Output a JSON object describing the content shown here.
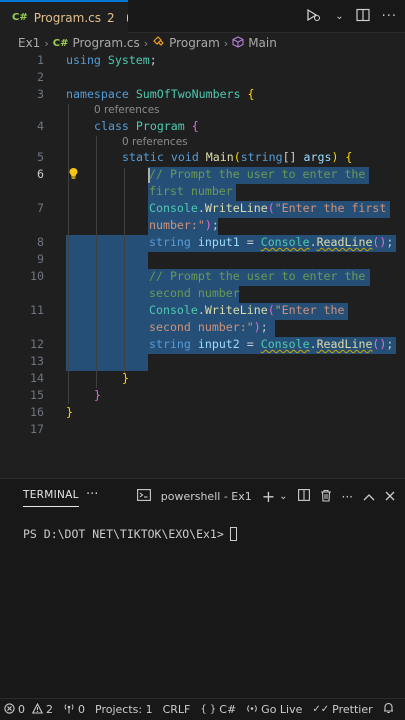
{
  "tab": {
    "lang_icon": "C#",
    "name": "Program.cs",
    "problems": "2"
  },
  "breadcrumb": {
    "folder": "Ex1",
    "file_icon": "C#",
    "file": "Program.cs",
    "class": "Program",
    "method": "Main"
  },
  "editor": {
    "line_numbers": [
      "1",
      "2",
      "3",
      "4",
      "5",
      "6",
      "7",
      "8",
      "9",
      "10",
      "11",
      "12",
      "13",
      "14",
      "15",
      "16",
      "17"
    ],
    "code": {
      "l1_kw": "using",
      "l1_ns": "System",
      "l3_kw": "namespace",
      "l3_name": "SumOfTwoNumbers",
      "l4_kw": "class",
      "l4_name": "Program",
      "l5_static": "static",
      "l5_void": "void",
      "l5_main": "Main",
      "l5_string": "string",
      "l5_args": "args",
      "l6_comment_a": "// Prompt the user to enter the",
      "l6_comment_b": "first number",
      "l7_console": "Console",
      "l7_method": "WriteLine",
      "l7_str_a": "\"Enter the first",
      "l7_str_b": "number:\"",
      "l8_string": "string",
      "l8_var": "input1",
      "l8_console": "Console",
      "l8_method": "ReadLine",
      "l10_comment_a": "// Prompt the user to enter the",
      "l10_comment_b": "second number",
      "l11_console": "Console",
      "l11_method": "WriteLine",
      "l11_str_a": "\"Enter the",
      "l11_str_b": "second number:\"",
      "l12_string": "string",
      "l12_var": "input2",
      "l12_console": "Console",
      "l12_method": "ReadLine"
    },
    "lens_class": "0 references",
    "lens_method": "0 references"
  },
  "panel": {
    "tab_terminal": "TERMINAL",
    "shell_name": "powershell - Ex1",
    "prompt": "PS D:\\DOT NET\\TIKTOK\\EXO\\Ex1>"
  },
  "statusbar": {
    "errors": "0",
    "warnings": "2",
    "ports": "0",
    "projects": "Projects: 1",
    "eol": "CRLF",
    "language": "C#",
    "golive": "Go Live",
    "prettier": "Prettier"
  }
}
